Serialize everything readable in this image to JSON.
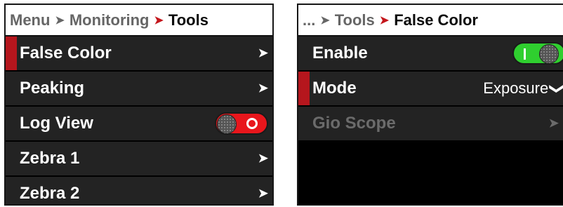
{
  "left": {
    "breadcrumb": [
      "Menu",
      "Monitoring",
      "Tools"
    ],
    "items": [
      {
        "label": "False Color",
        "control": "chevron",
        "selected": true
      },
      {
        "label": "Peaking",
        "control": "chevron",
        "selected": false
      },
      {
        "label": "Log View",
        "control": "toggle",
        "toggle_state": "off",
        "selected": false
      },
      {
        "label": "Zebra 1",
        "control": "chevron",
        "selected": false
      },
      {
        "label": "Zebra 2",
        "control": "chevron",
        "selected": false
      }
    ]
  },
  "right": {
    "breadcrumb": [
      "...",
      "Tools",
      "False Color"
    ],
    "items": [
      {
        "label": "Enable",
        "control": "toggle",
        "toggle_state": "on",
        "selected": false
      },
      {
        "label": "Mode",
        "control": "dropdown",
        "value": "Exposure",
        "selected": true
      },
      {
        "label": "Gio Scope",
        "control": "chevron",
        "disabled": true
      }
    ]
  },
  "colors": {
    "accent_red": "#c4161c",
    "toggle_on": "#2fcf2f",
    "toggle_off": "#e8161c",
    "row_bg": "#232323"
  }
}
